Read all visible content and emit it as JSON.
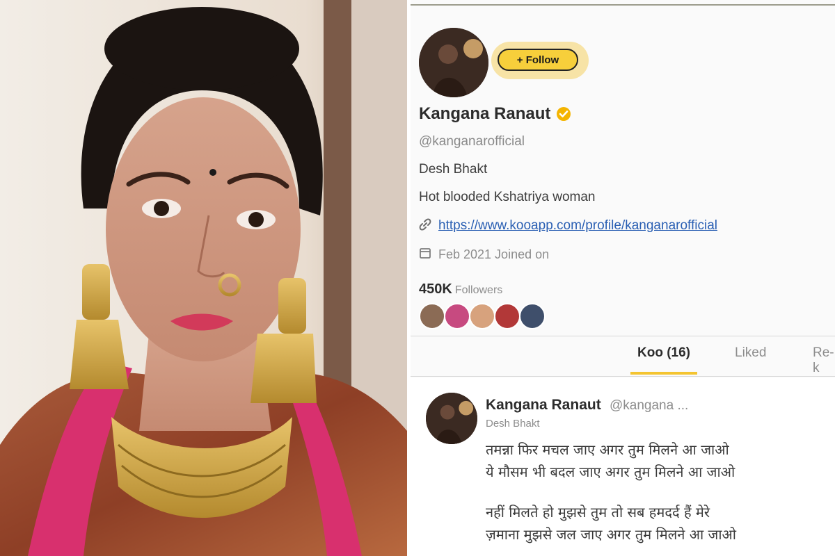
{
  "profile": {
    "follow_label": "+ Follow",
    "name": "Kangana Ranaut",
    "handle": "@kanganarofficial",
    "bio_line1": "Desh Bhakt",
    "bio_line2": "Hot blooded Kshatriya woman",
    "link": "https://www.kooapp.com/profile/kanganarofficial",
    "joined": "Feb 2021 Joined on",
    "followers_count": "450K",
    "followers_label": "Followers"
  },
  "tabs": [
    "Koo (16)",
    "Liked",
    "Re-k"
  ],
  "post": {
    "author_name": "Kangana Ranaut",
    "author_handle": "@kangana ...",
    "author_bio": "Desh Bhakt",
    "lines": [
      "तमन्ना फिर मचल जाए अगर तुम मिलने आ जाओ",
      "ये मौसम भी बदल जाए अगर तुम मिलने आ जाओ",
      "नहीं मिलते हो मुझसे तुम तो सब हमदर्द हैं मेरे",
      "ज़माना मुझसे जल जाए अगर तुम मिलने आ जाओ"
    ]
  },
  "colors": {
    "follow_button": "#f7cf3b",
    "follow_halo": "#f7e3a6",
    "verified_badge": "#f4b400",
    "tab_underline": "#f4c430",
    "link": "#2a5fb3"
  },
  "icons": [
    "verified-badge-icon",
    "link-icon",
    "calendar-icon"
  ]
}
